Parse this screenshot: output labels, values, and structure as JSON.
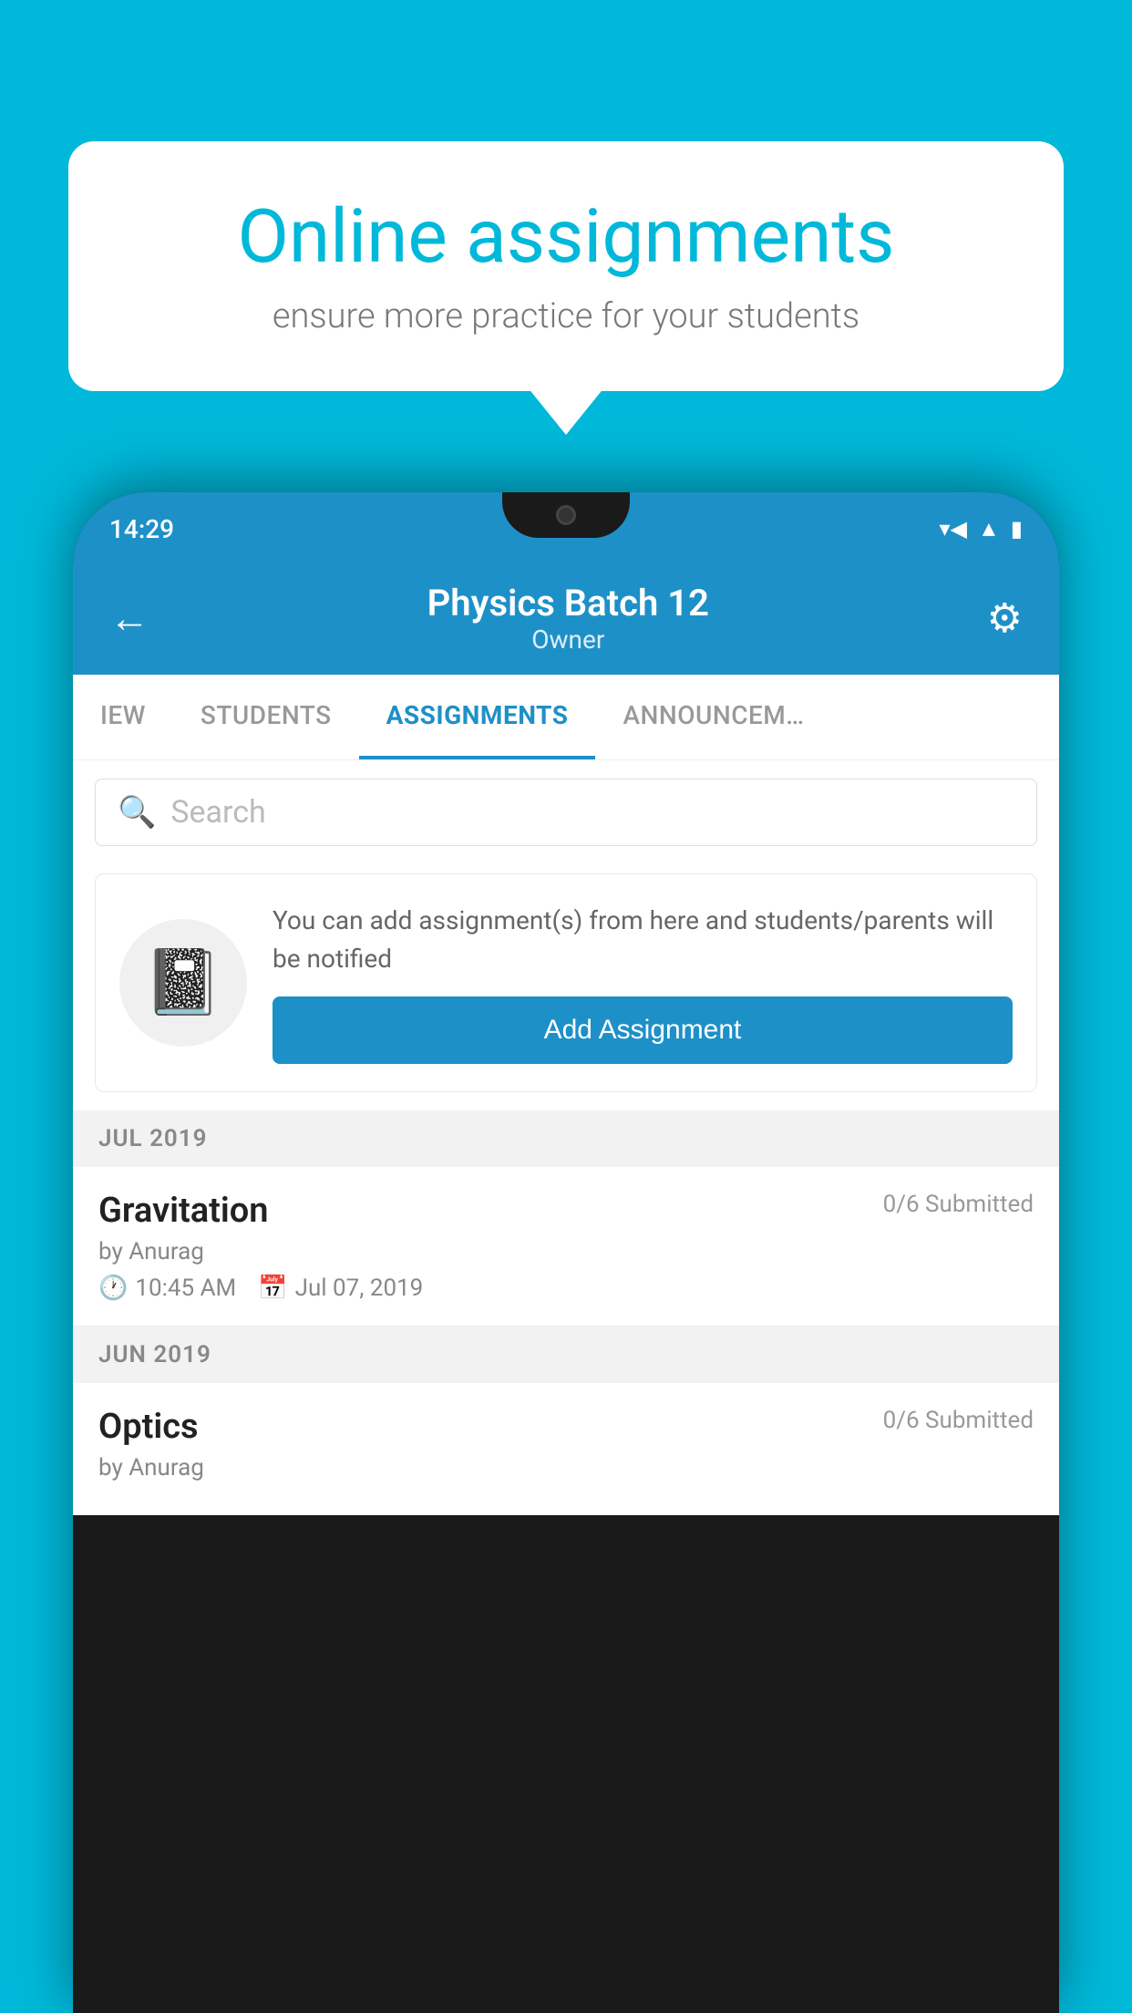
{
  "background_color": "#00B8D9",
  "speech_bubble": {
    "headline": "Online assignments",
    "subtext": "ensure more practice for your students"
  },
  "status_bar": {
    "time": "14:29",
    "wifi": "▾",
    "signal": "▲",
    "battery": "▮"
  },
  "header": {
    "title": "Physics Batch 12",
    "subtitle": "Owner",
    "back_label": "←",
    "settings_label": "⚙"
  },
  "tabs": [
    {
      "label": "IEW",
      "active": false
    },
    {
      "label": "STUDENTS",
      "active": false
    },
    {
      "label": "ASSIGNMENTS",
      "active": true
    },
    {
      "label": "ANNOUNCEM…",
      "active": false
    }
  ],
  "search": {
    "placeholder": "Search"
  },
  "empty_state": {
    "description": "You can add assignment(s) from here and students/parents will be notified",
    "button_label": "Add Assignment"
  },
  "sections": [
    {
      "label": "JUL 2019",
      "assignments": [
        {
          "title": "Gravitation",
          "submitted": "0/6 Submitted",
          "by": "by Anurag",
          "time": "10:45 AM",
          "date": "Jul 07, 2019"
        }
      ]
    },
    {
      "label": "JUN 2019",
      "assignments": [
        {
          "title": "Optics",
          "submitted": "0/6 Submitted",
          "by": "by Anurag",
          "time": "",
          "date": ""
        }
      ]
    }
  ]
}
